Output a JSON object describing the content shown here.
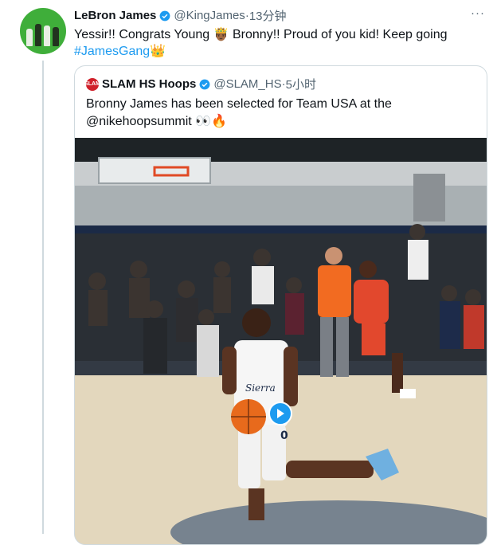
{
  "tweet": {
    "author_name": "LeBron James",
    "author_handle": "@KingJames",
    "separator": "·",
    "time": "13分钟",
    "more": "···",
    "text_line1": "Yessir!! Congrats Young 🤴🏾 Bronny!! Proud of you kid! Keep going",
    "hashtag": "#JamesGang",
    "hashtag_emoji": "👑"
  },
  "quoted_tweet": {
    "logo_text": "SLAM",
    "author_name": "SLAM HS Hoops",
    "author_handle": "@SLAM_HS",
    "separator": "·",
    "time": "5小时",
    "text_line1": "Bronny James has been selected for Team USA at the",
    "text_line2": "@nikehoopsummit 👀🔥",
    "jersey_text": "Sierra",
    "jersey_number": "0"
  },
  "colors": {
    "accent": "#1d9bf0",
    "verified": "#1d9bf0",
    "avatar_bg": "#3fae3a",
    "slam_red": "#d0202a",
    "text_primary": "#0f1419",
    "text_secondary": "#536471",
    "border": "#cfd9de"
  },
  "icons": {
    "verified": "verified-badge-icon",
    "more": "more-icon",
    "play": "play-icon"
  }
}
